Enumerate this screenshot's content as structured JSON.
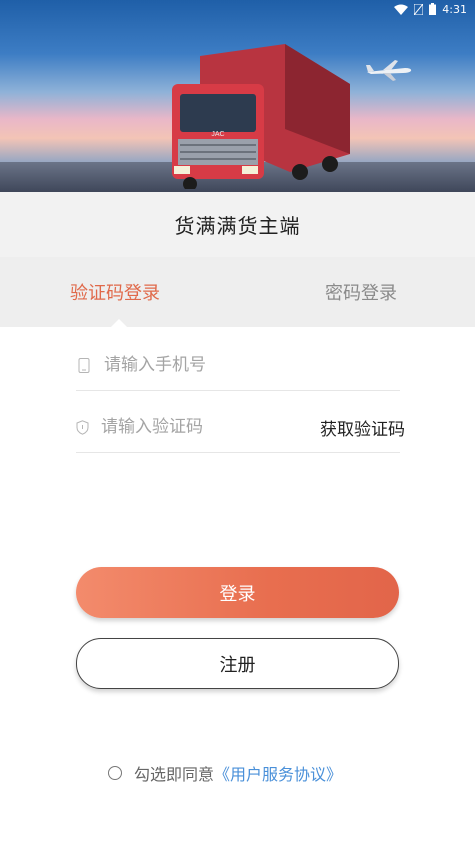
{
  "status_bar": {
    "time": "4:31",
    "icons": [
      "wifi-icon",
      "signal-icon",
      "battery-icon"
    ]
  },
  "header": {
    "title": "货满满货主端"
  },
  "tabs": [
    {
      "label": "验证码登录",
      "active": true
    },
    {
      "label": "密码登录",
      "active": false
    }
  ],
  "form": {
    "phone_placeholder": "请输入手机号",
    "code_placeholder": "请输入验证码",
    "get_code_label": "获取验证码"
  },
  "buttons": {
    "login": "登录",
    "register": "注册"
  },
  "agreement": {
    "text": "勾选即同意",
    "link": "《用户服务协议》"
  },
  "hero": {
    "truck_badge": "JAC"
  },
  "colors": {
    "accent": "#e86e4f",
    "link": "#4a90d9",
    "inactive_tab": "#8a8a8a"
  }
}
